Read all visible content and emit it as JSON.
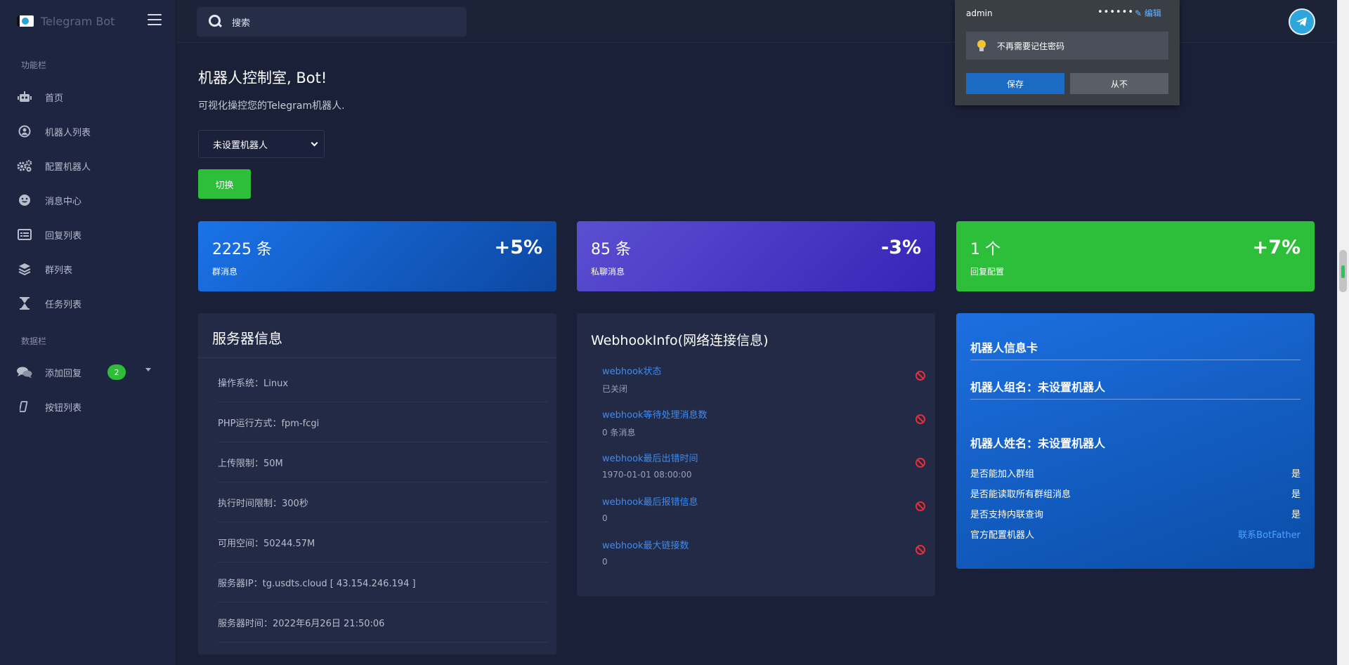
{
  "app": {
    "title": "Telegram Bot"
  },
  "sidebar": {
    "section_main": "功能栏",
    "items": [
      {
        "label": "首页",
        "icon": "robot-icon"
      },
      {
        "label": "机器人列表",
        "icon": "user-circle-icon"
      },
      {
        "label": "配置机器人",
        "icon": "gears-icon"
      },
      {
        "label": "消息中心",
        "icon": "smile-icon"
      },
      {
        "label": "回复列表",
        "icon": "list-card-icon"
      },
      {
        "label": "群列表",
        "icon": "layers-icon"
      },
      {
        "label": "任务列表",
        "icon": "hourglass-icon"
      }
    ],
    "section_data": "数据栏",
    "data_items": [
      {
        "label": "添加回复",
        "icon": "comments-icon",
        "badge": "2"
      },
      {
        "label": "按钮列表",
        "icon": "mobile-icon"
      }
    ]
  },
  "search": {
    "placeholder": "搜索"
  },
  "password_popup": {
    "username": "admin",
    "password_mask": "••••••",
    "edit_label": "编辑",
    "note": "不再需要记住密码",
    "save_label": "保存",
    "never_label": "从不"
  },
  "header": {
    "title": "机器人控制室, Bot!",
    "subtitle": "可视化操控您的Telegram机器人."
  },
  "bot_select": {
    "selected": "未设置机器人"
  },
  "switch_button": "切换",
  "stats": [
    {
      "value": "2225 条",
      "label": "群消息",
      "change": "+5%",
      "color_from": "#1a73e8",
      "color_to": "#0d47a1"
    },
    {
      "value": "85 条",
      "label": "私聊消息",
      "change": "-3%",
      "color_from": "#5b4fd1",
      "color_to": "#3624b8"
    },
    {
      "value": "1 个",
      "label": "回复配置",
      "change": "+7%",
      "color_from": "#2dbe3a",
      "color_to": "#2dbe3a"
    }
  ],
  "server": {
    "title": "服务器信息",
    "rows": [
      "操作系统：Linux",
      "PHP运行方式：fpm-fcgi",
      "上传限制：50M",
      "执行时间限制：300秒",
      "可用空间：50244.57M",
      "服务器IP：tg.usdts.cloud [ 43.154.246.194 ]",
      "服务器时间：2022年6月26日 21:50:06"
    ]
  },
  "webhook": {
    "title": "WebhookInfo(网络连接信息)",
    "items": [
      {
        "key": "webhook状态",
        "value": "已关闭"
      },
      {
        "key": "webhook等待处理消息数",
        "value": "0 条消息"
      },
      {
        "key": "webhook最后出错时间",
        "value": "1970-01-01 08:00:00"
      },
      {
        "key": "webhook最后报错信息",
        "value": "0"
      },
      {
        "key": "webhook最大链接数",
        "value": "0"
      }
    ]
  },
  "bot_info": {
    "title": "机器人信息卡",
    "group_name": "机器人组名：未设置机器人",
    "bot_name": "机器人姓名：未设置机器人",
    "rows": [
      {
        "label": "是否能加入群组",
        "value": "是"
      },
      {
        "label": "是否能读取所有群组消息",
        "value": "是"
      },
      {
        "label": "是否支持内联查询",
        "value": "是"
      },
      {
        "label": "官方配置机器人",
        "value": "联系BotFather"
      }
    ]
  }
}
